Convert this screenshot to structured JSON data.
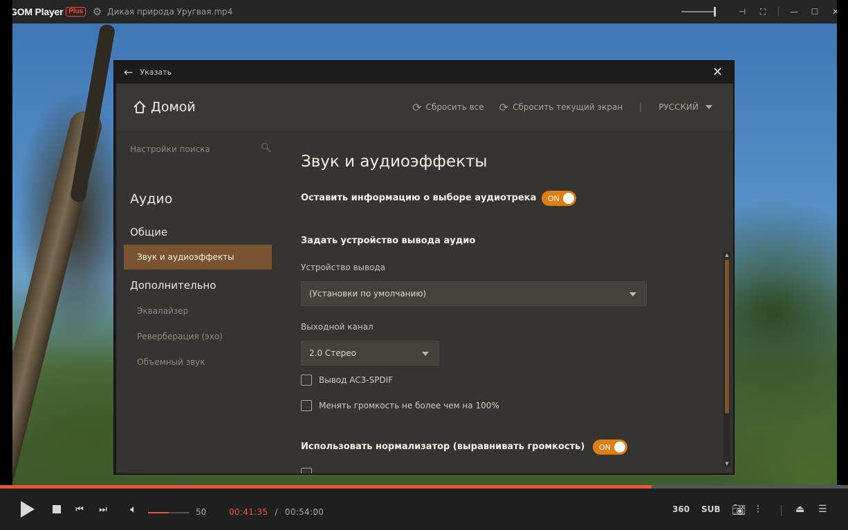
{
  "titlebar": {
    "app_name": "GOM Player",
    "plus_label": "Plus",
    "file_name": "Дикая природа Уругвая.mp4"
  },
  "colors": {
    "accent": "#e07d12",
    "active_item": "#7a5430",
    "progress": "#e8573a"
  },
  "dialog": {
    "title": "Указать",
    "home_label": "Домой",
    "reset_all": "Сбросить все",
    "reset_current": "Сбросить текущий экран",
    "separator": "|",
    "language": "РУССКИЙ"
  },
  "sidebar": {
    "search_placeholder": "Настройки поиска",
    "category": "Аудио",
    "groups": {
      "general": "Общие",
      "advanced": "Дополнительно"
    },
    "items": [
      {
        "label": "Звук и аудиоэффекты",
        "active": true
      },
      {
        "label": "Эквалайзер",
        "active": false
      },
      {
        "label": "Реверберация (эхо)",
        "active": false
      },
      {
        "label": "Объемный звук",
        "active": false
      }
    ]
  },
  "content": {
    "heading": "Звук и аудиоэффекты",
    "keep_track_label": "Оставить информацию о выборе аудиотрека",
    "keep_track_toggle": "ON",
    "output_section": "Задать устройство вывода аудио",
    "device_label": "Устройство вывода",
    "device_value": "(Установки по умолчанию)",
    "channel_label": "Выходной канал",
    "channel_value": "2.0 Стерео",
    "check_ac3": "Вывод AC3-SPDIF",
    "check_volume": "Менять громкость не более чем на 100%",
    "normalizer_label": "Использовать нормализатор (выравнивать громкость)",
    "normalizer_toggle": "ON"
  },
  "player": {
    "progress_fraction": 0.768,
    "volume_level": 50,
    "volume_value": "50",
    "current_time": "00:41:35",
    "time_separator": "/",
    "total_time": "00:54:00",
    "btn_360": "360",
    "btn_sub": "SUB"
  }
}
